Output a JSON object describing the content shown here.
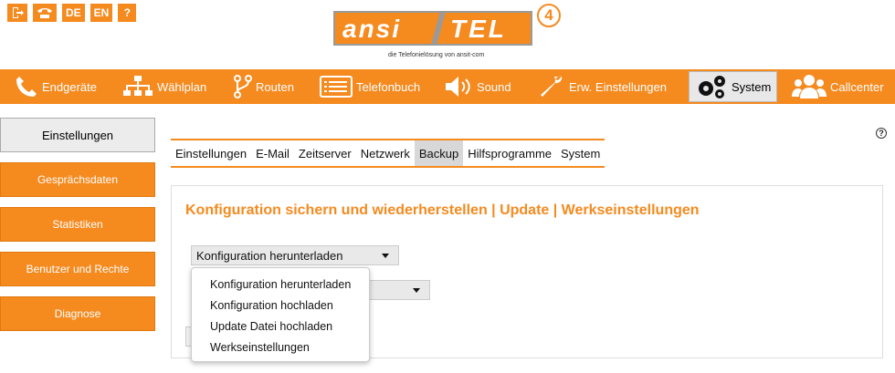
{
  "top_icons": [
    {
      "name": "logout-icon",
      "label": ""
    },
    {
      "name": "phone-icon",
      "label": ""
    },
    {
      "name": "lang-de",
      "label": "DE"
    },
    {
      "name": "lang-en",
      "label": "EN"
    },
    {
      "name": "help-question-icon",
      "label": "?"
    }
  ],
  "logo": {
    "left": "ansi",
    "right": "TEL",
    "version": "4",
    "tagline": "die Telefonielösung von ansit-com"
  },
  "nav": {
    "items": [
      {
        "label": "Endgeräte",
        "icon": "phone-icon"
      },
      {
        "label": "Wählplan",
        "icon": "sitemap-icon"
      },
      {
        "label": "Routen",
        "icon": "route-icon"
      },
      {
        "label": "Telefonbuch",
        "icon": "phonebook-icon"
      },
      {
        "label": "Sound",
        "icon": "speaker-icon"
      },
      {
        "label": "Erw. Einstellungen",
        "icon": "wrench-icon"
      },
      {
        "label": "System",
        "icon": "gears-icon"
      },
      {
        "label": "Callcenter",
        "icon": "users-icon"
      }
    ],
    "active": "System"
  },
  "sidebar": {
    "items": [
      {
        "label": "Einstellungen"
      },
      {
        "label": "Gesprächsdaten"
      },
      {
        "label": "Statistiken"
      },
      {
        "label": "Benutzer und Rechte"
      },
      {
        "label": "Diagnose"
      }
    ],
    "active": "Einstellungen"
  },
  "help": {
    "label": "?"
  },
  "subtabs": {
    "items": [
      {
        "label": "Einstellungen"
      },
      {
        "label": "E-Mail"
      },
      {
        "label": "Zeitserver"
      },
      {
        "label": "Netzwerk"
      },
      {
        "label": "Backup"
      },
      {
        "label": "Hilfsprogramme"
      },
      {
        "label": "System"
      }
    ],
    "active": "Backup"
  },
  "panel": {
    "title": "Konfiguration sichern und wiederherstellen | Update | Werkseinstellungen",
    "select1_value": "Konfiguration herunterladen",
    "select2_value": ""
  },
  "dropdown": {
    "options": [
      {
        "label": "Konfiguration herunterladen"
      },
      {
        "label": "Konfiguration hochladen"
      },
      {
        "label": "Update Datei hochladen"
      },
      {
        "label": "Werkseinstellungen"
      }
    ]
  },
  "colors": {
    "accent": "#f58a1f",
    "active_bg": "#e8e8e8"
  }
}
